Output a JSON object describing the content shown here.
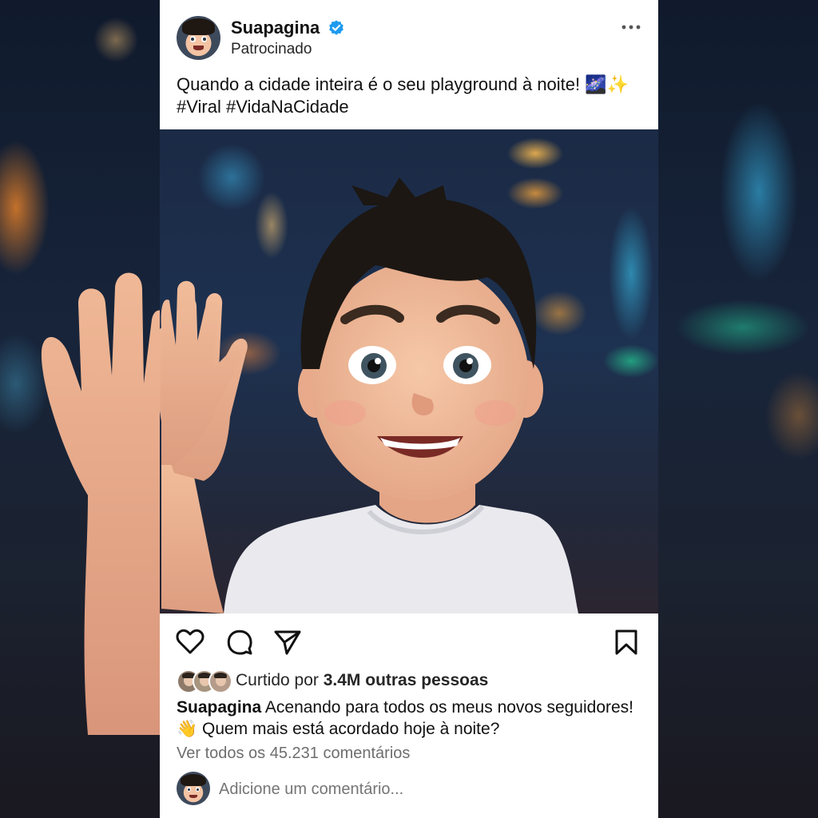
{
  "post": {
    "page_name": "Suapagina",
    "sponsored_label": "Patrocinado",
    "caption_line1": "Quando a cidade inteira é o seu playground à noite! 🌌✨",
    "caption_line2": "#Viral #VidaNaCidade"
  },
  "engagement": {
    "likes_prefix": "Curtido por ",
    "likes_count": "3.4M outras pessoas",
    "caption_user": "Suapagina",
    "caption_text": " Acenando para todos os meus novos seguidores! 👋 Quem mais está acordado hoje à noite?",
    "view_comments": "Ver todos os 45.231 comentários",
    "comment_placeholder": "Adicione um comentário..."
  },
  "icons": {
    "verified": "verified-badge-icon",
    "more": "more-horizontal-icon",
    "like": "heart-icon",
    "comment": "comment-bubble-icon",
    "share": "paper-plane-icon",
    "save": "bookmark-icon"
  },
  "colors": {
    "verified_blue": "#1d9bf0",
    "text_primary": "#111111",
    "text_secondary": "#6e6e6e",
    "card_background": "#ffffff"
  }
}
